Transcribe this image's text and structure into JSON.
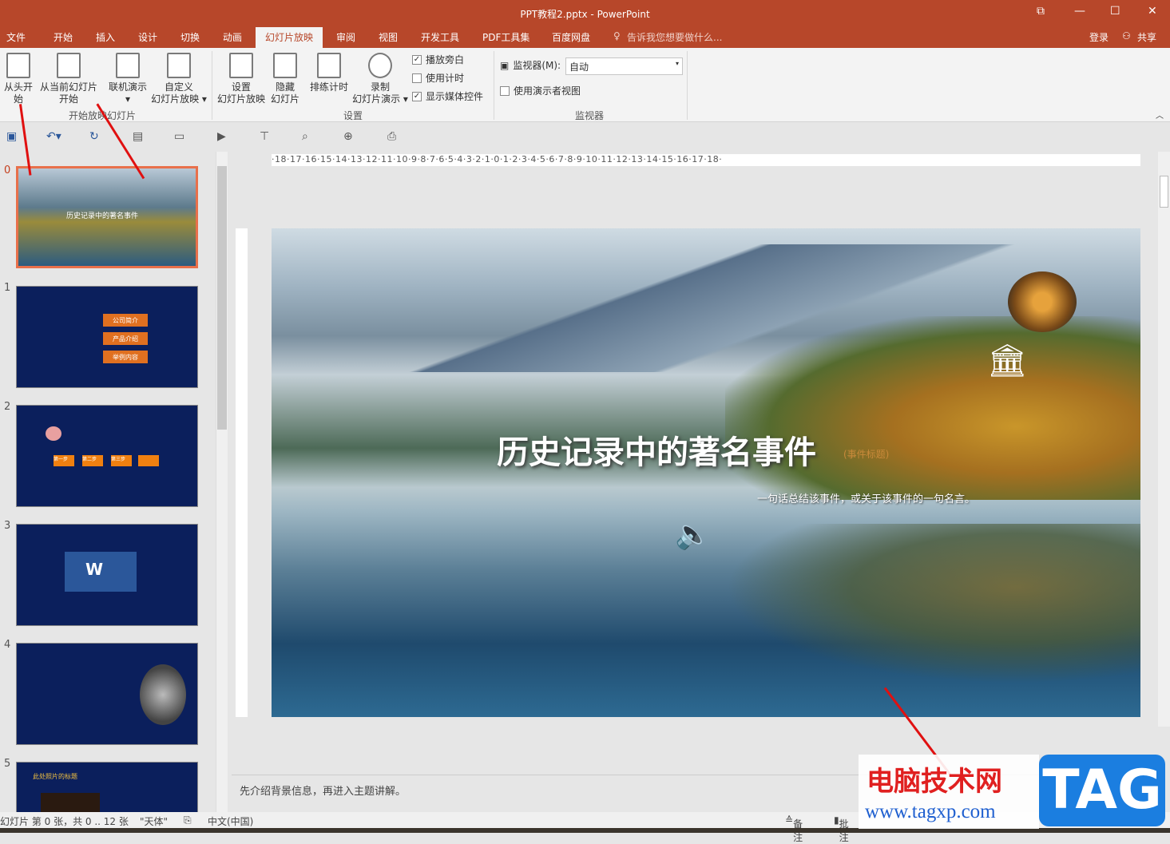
{
  "window": {
    "title": "PPT教程2.pptx - PowerPoint",
    "controls": [
      "⧉",
      "—",
      "☐",
      "✕"
    ]
  },
  "tabs": [
    "文件",
    "开始",
    "插入",
    "设计",
    "切换",
    "动画",
    "幻灯片放映",
    "审阅",
    "视图",
    "开发工具",
    "PDF工具集",
    "百度网盘"
  ],
  "tell_me": "告诉我您想要做什么...",
  "account": {
    "login": "登录",
    "share": "共享"
  },
  "ribbon": {
    "start": {
      "from_beginning": "从头开始",
      "from_current": "从当前幻灯片",
      "from_current2": "开始",
      "online": "联机演示",
      "custom": "自定义",
      "custom2": "幻灯片放映",
      "group": "开始放映幻灯片"
    },
    "setup": {
      "setup": "设置",
      "setup2": "幻灯片放映",
      "hide": "隐藏",
      "hide2": "幻灯片",
      "rehearse": "排练计时",
      "record": "录制",
      "record2": "幻灯片演示",
      "play_narrations": "播放旁白",
      "use_timings": "使用计时",
      "show_media": "显示媒体控件",
      "group": "设置"
    },
    "monitors": {
      "monitor_label": "监视器(M):",
      "monitor_value": "自动",
      "presenter_view": "使用演示者视图",
      "group": "监视器"
    }
  },
  "checks": {
    "play_narrations": true,
    "use_timings": false,
    "show_media": true,
    "presenter_view": false
  },
  "ruler": "·18·17·16·15·14·13·12·11·10·9·8·7·6·5·4·3·2·1·0·1·2·3·4·5·6·7·8·9·10·11·12·13·14·15·16·17·18·",
  "thumbnails": [
    {
      "num": "0",
      "label": "历史记录中的著名事件"
    },
    {
      "num": "1",
      "items": [
        "公司简介",
        "产品介绍",
        "举例内容"
      ]
    },
    {
      "num": "2",
      "items": [
        "第一步",
        "第二步",
        "第三步"
      ]
    },
    {
      "num": "3"
    },
    {
      "num": "4"
    },
    {
      "num": "5",
      "label": "此处照片的标题"
    }
  ],
  "slide": {
    "title": "历史记录中的著名事件",
    "subtitle": "(事件标题)",
    "line": "一句话总结该事件，或关于该事件的一句名言。"
  },
  "notes": "先介绍背景信息，再进入主题讲解。",
  "status": {
    "slide_info": "幻灯片 第 0 张，共 0 .. 12 张",
    "theme": "\"天体\"",
    "language": "中文(中国)",
    "notes": "备注",
    "comments": "批注"
  },
  "watermark": {
    "text": "电脑技术网",
    "url": "www.tagxp.com",
    "tag": "TAG"
  }
}
